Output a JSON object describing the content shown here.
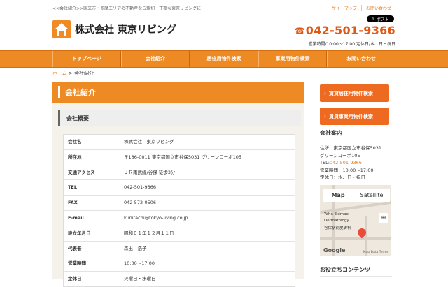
{
  "header": {
    "tagline": "<<会社紹介>>国立市・多摩エリアの不動産なら親切・丁寧な東京リビングに！",
    "links": [
      "サイトマップ",
      "お問い合わせ"
    ],
    "x_post": "ポスト",
    "company": "株式会社 東京リビング",
    "phone": "042-501-9366",
    "hours": "営業時間/10:00〜17:00 定休日/水、日・祝日",
    "icon_logo": "house-icon",
    "icon_phone": "phone-icon",
    "icon_x": "x-icon"
  },
  "nav": {
    "items": [
      "トップページ",
      "会社紹介",
      "居住用物件検索",
      "事業用物件検索",
      "お問い合わせ"
    ]
  },
  "breadcrumb": {
    "home": "ホーム",
    "sep": ">",
    "current": "会社紹介"
  },
  "main": {
    "title": "会社紹介",
    "section": "会社概要",
    "rows": [
      {
        "label": "会社名",
        "value": "株式会社　東京リビング"
      },
      {
        "label": "所在地",
        "value": "〒186-0011 東京都国立市谷保5031 グリーンコーポ105"
      },
      {
        "label": "交通アクセス",
        "value": "ＪＲ南武線/谷保 徒歩3分"
      },
      {
        "label": "TEL",
        "value": "042-501-9366"
      },
      {
        "label": "FAX",
        "value": "042-572-0506"
      },
      {
        "label": "E-mail",
        "value": "kunitachi@tokyo-living.co.jp"
      },
      {
        "label": "設立年月日",
        "value": "昭和６１年１２月１１日"
      },
      {
        "label": "代表者",
        "value": "森出　浩子"
      },
      {
        "label": "営業時間",
        "value": "10:00〜17:00"
      },
      {
        "label": "定休日",
        "value": "火曜日・水曜日"
      }
    ]
  },
  "sidebar": {
    "buttons": [
      "賃貸居住用物件検索",
      "賃貸事業用物件検索"
    ],
    "company_title": "会社案内",
    "address_1": "住所：東京都国立市谷保5031",
    "address_2": "グリーンコーポ105",
    "tel_label": "TEL:",
    "tel": "042-501-9366",
    "hours": "営業時間：10:00〜17:00",
    "closed": "定休日：水、日・祝日",
    "map_tab": "Map",
    "satellite_tab": "Satellite",
    "map_label_1": "Yaho Ekimae",
    "map_label_2": "Dermatology",
    "map_label_3": "谷保駅前皮膚科",
    "google": "Google",
    "map_footer": "Map Data  Terms",
    "tips_title": "お役立ちコンテンツ"
  },
  "colors": {
    "accent": "#ee8a24",
    "button": "#ef6a21",
    "phone": "#e05a14"
  }
}
